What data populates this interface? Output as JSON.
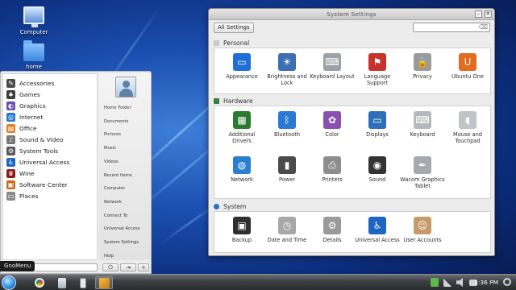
{
  "desktop": {
    "icons": [
      {
        "label": "Computer",
        "icon": "computer-icon"
      },
      {
        "label": "home",
        "icon": "home-folder-icon"
      }
    ]
  },
  "gnomenu": {
    "tooltip": "GnoMenu",
    "categories": [
      {
        "label": "Accessories",
        "icon": "accessories-icon",
        "color": "#4a4a4a",
        "glyph": "✎"
      },
      {
        "label": "Games",
        "icon": "games-icon",
        "color": "#3d3d3d",
        "glyph": "♠"
      },
      {
        "label": "Graphics",
        "icon": "graphics-icon",
        "color": "#6a4fb3",
        "glyph": "◐"
      },
      {
        "label": "Internet",
        "icon": "internet-icon",
        "color": "#2a78d0",
        "glyph": "◎"
      },
      {
        "label": "Office",
        "icon": "office-icon",
        "color": "#d9822b",
        "glyph": "▤"
      },
      {
        "label": "Sound & Video",
        "icon": "sound-video-icon",
        "color": "#777777",
        "glyph": "♪"
      },
      {
        "label": "System Tools",
        "icon": "system-tools-icon",
        "color": "#585858",
        "glyph": "⚙"
      },
      {
        "label": "Universal Access",
        "icon": "universal-access-icon",
        "color": "#1f66c4",
        "glyph": "♿"
      },
      {
        "label": "Wine",
        "icon": "wine-icon",
        "color": "#8c1c1c",
        "glyph": "♛"
      },
      {
        "label": "Software Center",
        "icon": "software-center-icon",
        "color": "#c86a1e",
        "glyph": "▣"
      },
      {
        "label": "Places",
        "icon": "places-icon",
        "color": "#8a8a8a",
        "glyph": "▭"
      }
    ],
    "places": [
      "Home Folder",
      "Documents",
      "Pictures",
      "Music",
      "Videos",
      "Recent Items",
      "Computer",
      "Network",
      "Connect To",
      "Universal Access",
      "System Settings",
      "Help"
    ],
    "power_glyph": "⏻",
    "logout_glyph": "⇥",
    "add_glyph": "+"
  },
  "taskbar": {
    "clock": "1:36 PM",
    "apps": [
      {
        "icon": "chrome-icon"
      },
      {
        "icon": "files-icon"
      },
      {
        "icon": "phone-icon"
      },
      {
        "icon": "settings-app-icon"
      }
    ]
  },
  "settings_window": {
    "title": "System Settings",
    "minimize_glyph": "–",
    "close_glyph": "✕",
    "all_settings_label": "All Settings",
    "search_placeholder": "",
    "search_glyph": "⌫",
    "sections": {
      "personal": {
        "title": "Personal",
        "items": [
          {
            "label": "Appearance",
            "icon": "appearance-icon",
            "color": "#1f6fd6",
            "glyph": "▭"
          },
          {
            "label": "Brightness and Lock",
            "icon": "brightness-lock-icon",
            "color": "#3c6fb2",
            "glyph": "☀"
          },
          {
            "label": "Keyboard Layout",
            "icon": "keyboard-layout-icon",
            "color": "#9aa1a8",
            "glyph": "⌨"
          },
          {
            "label": "Language Support",
            "icon": "language-support-icon",
            "color": "#c8322d",
            "glyph": "⚑"
          },
          {
            "label": "Privacy",
            "icon": "privacy-icon",
            "color": "#9a9a9a",
            "glyph": "🔒"
          },
          {
            "label": "Ubuntu One",
            "icon": "ubuntu-one-icon",
            "color": "#e36b1f",
            "glyph": "U"
          }
        ]
      },
      "hardware": {
        "title": "Hardware",
        "items": [
          {
            "label": "Additional Drivers",
            "icon": "additional-drivers-icon",
            "color": "#2c7a2f",
            "glyph": "▦"
          },
          {
            "label": "Bluetooth",
            "icon": "bluetooth-icon",
            "color": "#2b78d4",
            "glyph": "ᛒ"
          },
          {
            "label": "Color",
            "icon": "color-icon",
            "color": "#8a4fb2",
            "glyph": "✿"
          },
          {
            "label": "Displays",
            "icon": "displays-icon",
            "color": "#2e6fb8",
            "glyph": "▭"
          },
          {
            "label": "Keyboard",
            "icon": "keyboard-icon",
            "color": "#b5b9bd",
            "glyph": "⌨"
          },
          {
            "label": "Mouse and Touchpad",
            "icon": "mouse-touchpad-icon",
            "color": "#c0c4c8",
            "glyph": "◖"
          },
          {
            "label": "Network",
            "icon": "network-icon",
            "color": "#2a7fd1",
            "glyph": "◍"
          },
          {
            "label": "Power",
            "icon": "power-icon",
            "color": "#4b4b4b",
            "glyph": "▮"
          },
          {
            "label": "Printers",
            "icon": "printers-icon",
            "color": "#8d8d8d",
            "glyph": "⎙"
          },
          {
            "label": "Sound",
            "icon": "sound-icon",
            "color": "#333333",
            "glyph": "◉"
          },
          {
            "label": "Wacom Graphics Tablet",
            "icon": "wacom-tablet-icon",
            "color": "#a6a9ad",
            "glyph": "✒"
          }
        ]
      },
      "system": {
        "title": "System",
        "items": [
          {
            "label": "Backup",
            "icon": "backup-icon",
            "color": "#2f2f2f",
            "glyph": "▣"
          },
          {
            "label": "Date and Time",
            "icon": "date-time-icon",
            "color": "#a8a8a8",
            "glyph": "◷"
          },
          {
            "label": "Details",
            "icon": "details-icon",
            "color": "#9a9a9a",
            "glyph": "⚙"
          },
          {
            "label": "Universal Access",
            "icon": "universal-access-settings-icon",
            "color": "#1f66c4",
            "glyph": "♿"
          },
          {
            "label": "User Accounts",
            "icon": "user-accounts-icon",
            "color": "#c89a6a",
            "glyph": "☺"
          }
        ]
      }
    }
  }
}
